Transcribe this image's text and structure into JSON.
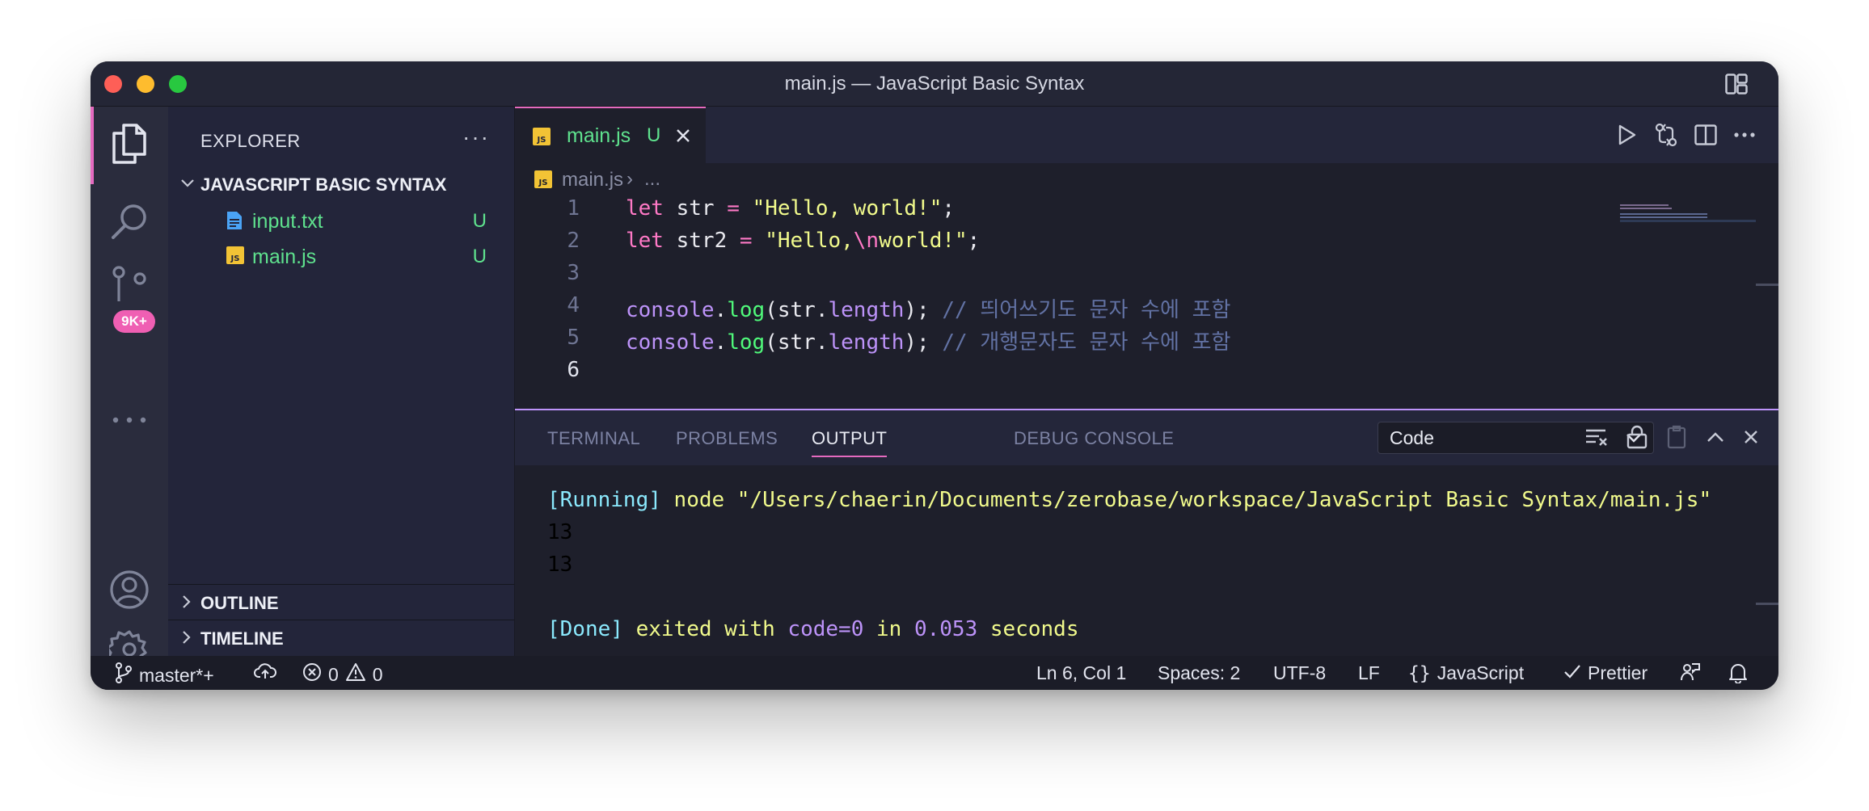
{
  "window": {
    "title": "main.js — JavaScript Basic Syntax"
  },
  "activity_bar": {
    "items": [
      {
        "icon": "files-icon",
        "active": true
      },
      {
        "icon": "search-icon"
      },
      {
        "icon": "source-control-icon",
        "badge": "9K+"
      },
      {
        "icon": "more-icon"
      }
    ],
    "bottom": [
      {
        "icon": "account-icon"
      },
      {
        "icon": "gear-icon"
      }
    ]
  },
  "sidebar": {
    "title": "EXPLORER",
    "folder": "JAVASCRIPT BASIC SYNTAX",
    "files": [
      {
        "name": "input.txt",
        "status": "U",
        "icon": "text-file-icon"
      },
      {
        "name": "main.js",
        "status": "U",
        "icon": "js-file-icon"
      }
    ],
    "sections": [
      "OUTLINE",
      "TIMELINE"
    ]
  },
  "editor": {
    "tab": {
      "name": "main.js",
      "status": "U"
    },
    "breadcrumb": {
      "file": "main.js",
      "rest": "..."
    },
    "lines": [
      {
        "n": "1",
        "tokens": [
          [
            "kw",
            "let"
          ],
          [
            "w",
            " str "
          ],
          [
            "kw",
            "="
          ],
          [
            "w",
            " "
          ],
          [
            "str",
            "\"Hello, world!\""
          ],
          [
            "w",
            ";"
          ]
        ]
      },
      {
        "n": "2",
        "tokens": [
          [
            "kw",
            "let"
          ],
          [
            "w",
            " str2 "
          ],
          [
            "kw",
            "="
          ],
          [
            "w",
            " "
          ],
          [
            "str",
            "\"Hello,"
          ],
          [
            "esc",
            "\\n"
          ],
          [
            "str",
            "world!\""
          ],
          [
            "w",
            ";"
          ]
        ]
      },
      {
        "n": "3",
        "tokens": []
      },
      {
        "n": "4",
        "tokens": [
          [
            "prop",
            "console"
          ],
          [
            "w",
            "."
          ],
          [
            "fn",
            "log"
          ],
          [
            "w",
            "(str."
          ],
          [
            "prop",
            "length"
          ],
          [
            "w",
            "); "
          ],
          [
            "cm",
            "// 띄어쓰기도 문자 수에 포함"
          ]
        ]
      },
      {
        "n": "5",
        "tokens": [
          [
            "prop",
            "console"
          ],
          [
            "w",
            "."
          ],
          [
            "fn",
            "log"
          ],
          [
            "w",
            "(str."
          ],
          [
            "prop",
            "length"
          ],
          [
            "w",
            "); "
          ],
          [
            "cm",
            "// 개행문자도 문자 수에 포함"
          ]
        ]
      },
      {
        "n": "6",
        "tokens": []
      }
    ]
  },
  "panel": {
    "tabs": [
      "TERMINAL",
      "PROBLEMS",
      "OUTPUT",
      "DEBUG CONSOLE"
    ],
    "active_tab": "OUTPUT",
    "channel": "Code",
    "output": {
      "running_tag": "[Running]",
      "running_cmd": " node \"/Users/chaerin/Documents/zerobase/workspace/JavaScript Basic Syntax/main.js\"",
      "line1": "13",
      "line2": "13",
      "done_tag": "[Done]",
      "done_a": " exited with ",
      "done_code": "code=0",
      "done_b": " in ",
      "done_time": "0.053",
      "done_c": " seconds"
    }
  },
  "statusbar": {
    "branch": "master*+",
    "errors": "0",
    "warnings": "0",
    "position": "Ln 6, Col 1",
    "spaces": "Spaces: 2",
    "encoding": "UTF-8",
    "eol": "LF",
    "language": "JavaScript",
    "formatter": "Prettier"
  },
  "colors": {
    "accent": "#e46abf",
    "git_untracked": "#5fe28e",
    "badge": "#ef5fb3"
  }
}
